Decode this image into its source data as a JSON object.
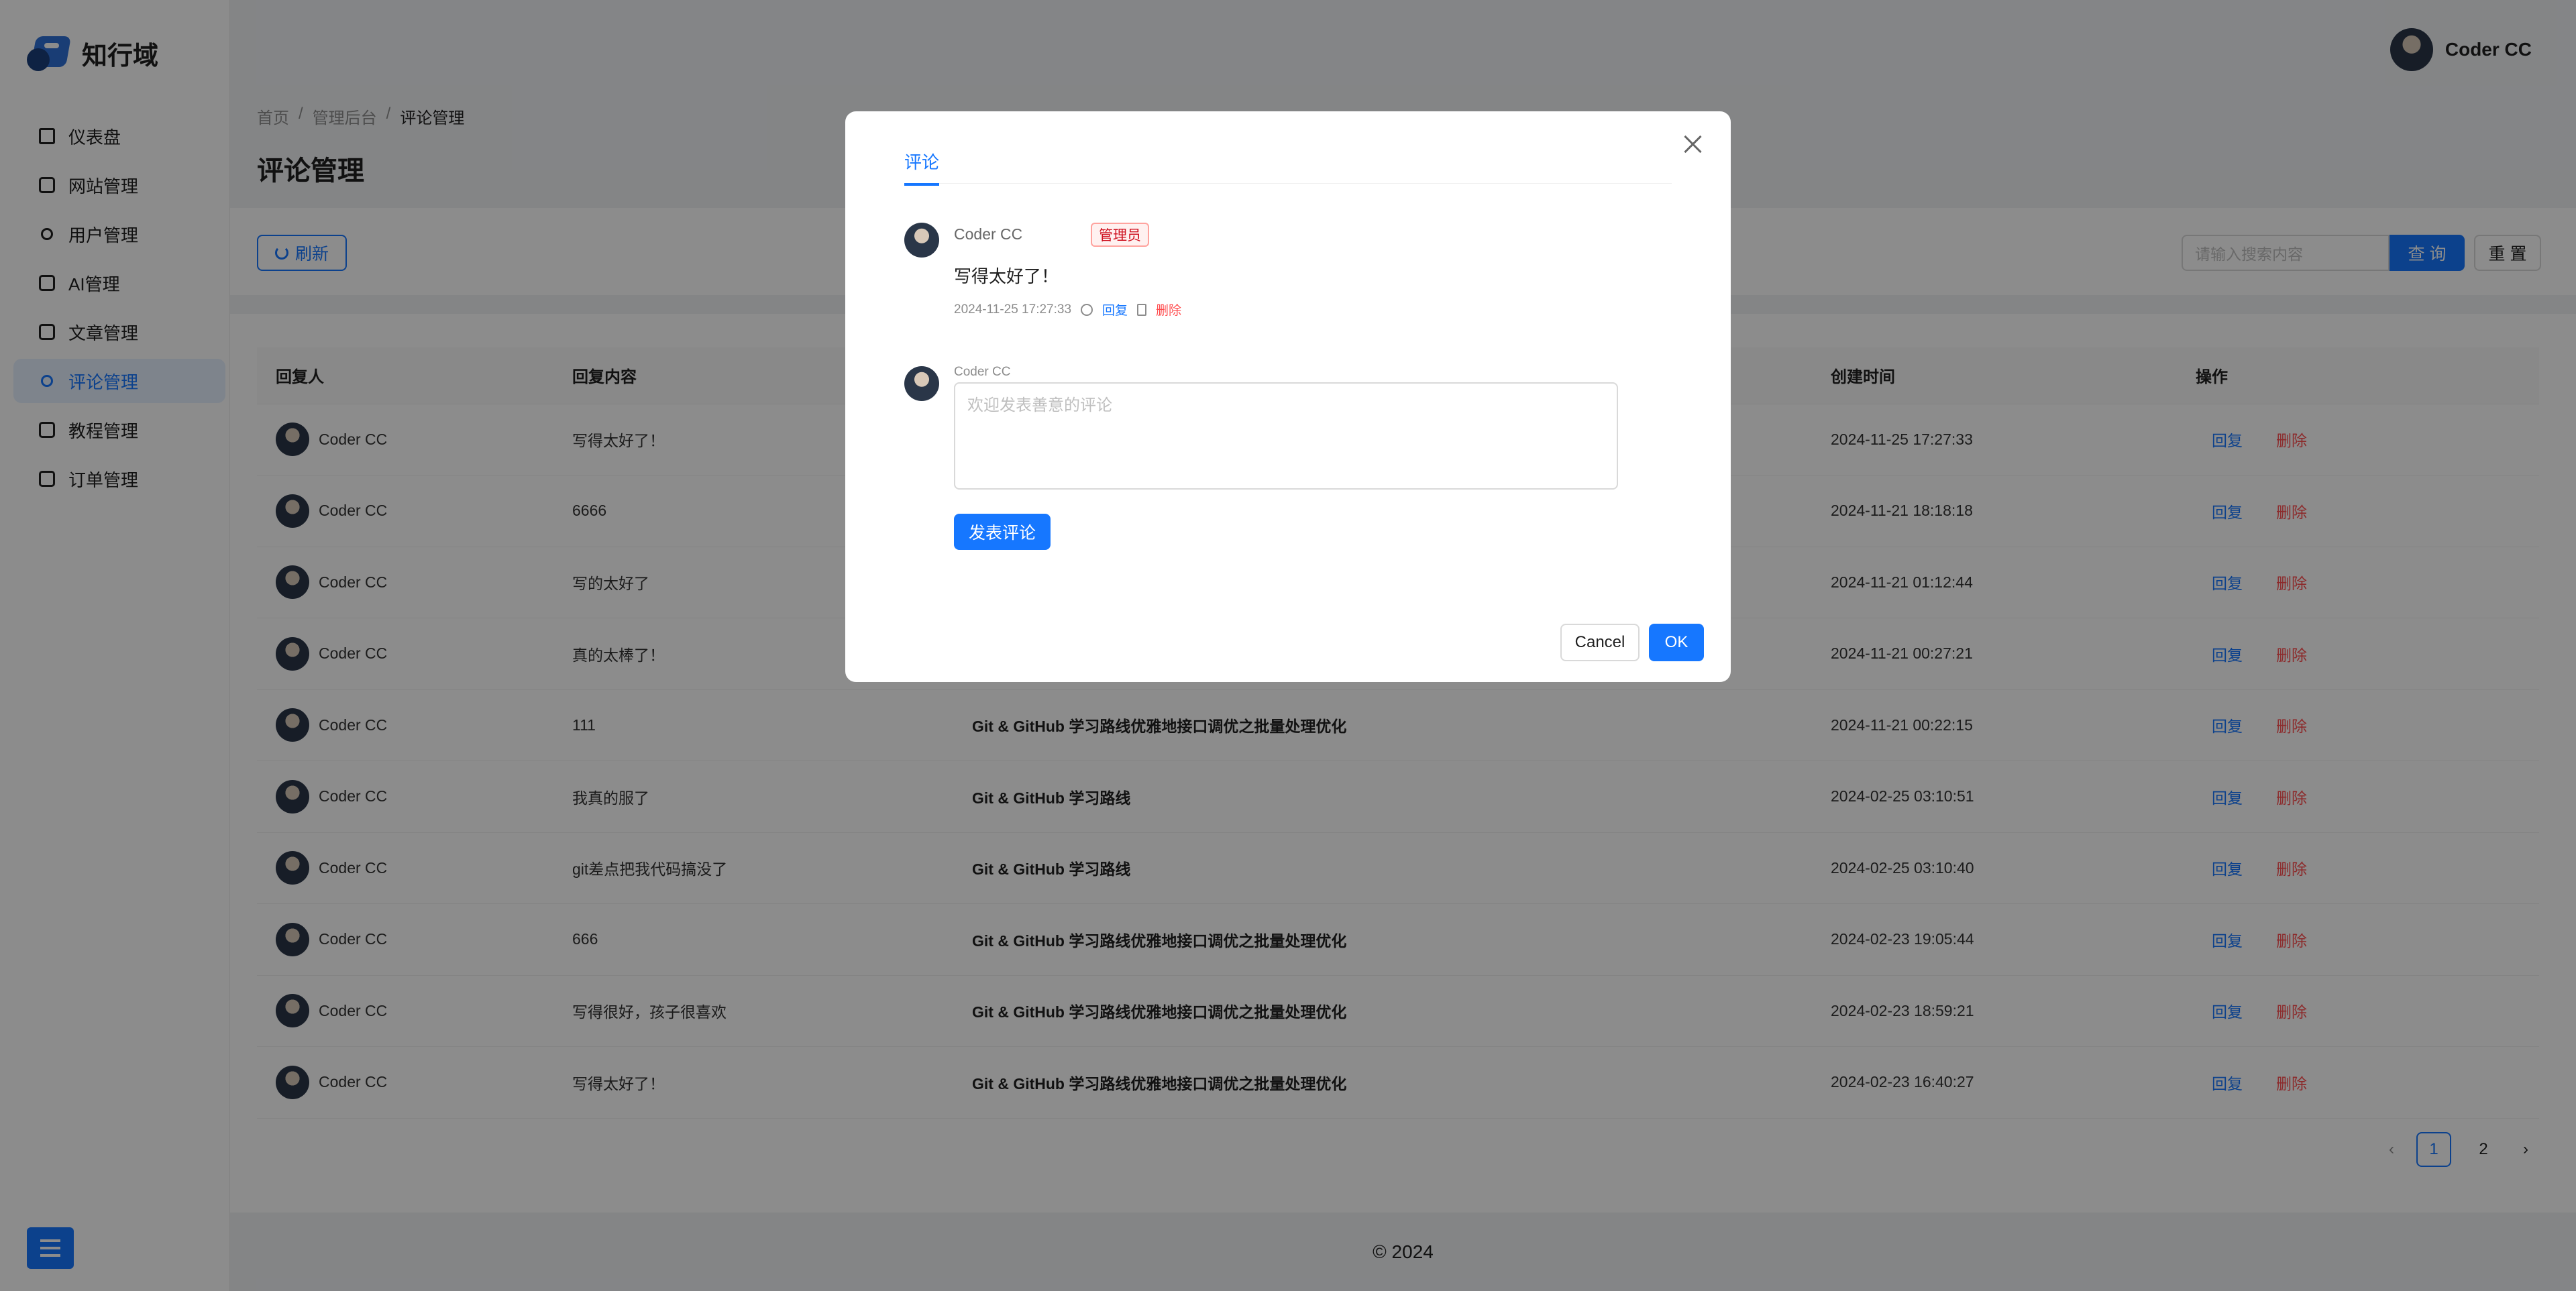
{
  "brand": {
    "name": "知行域"
  },
  "sidebar": {
    "items": [
      {
        "label": "仪表盘",
        "icon": "home-icon"
      },
      {
        "label": "网站管理",
        "icon": "grid-icon"
      },
      {
        "label": "用户管理",
        "icon": "user-icon"
      },
      {
        "label": "AI管理",
        "icon": "ai-icon"
      },
      {
        "label": "文章管理",
        "icon": "article-icon"
      },
      {
        "label": "评论管理",
        "icon": "comment-icon",
        "active": true
      },
      {
        "label": "教程管理",
        "icon": "tutorial-icon"
      },
      {
        "label": "订单管理",
        "icon": "order-icon"
      }
    ]
  },
  "header": {
    "user_name": "Coder CC"
  },
  "breadcrumb": [
    "首页",
    "管理后台",
    "评论管理"
  ],
  "page_title": "评论管理",
  "toolbar": {
    "refresh_label": "刷新",
    "search_placeholder": "请输入搜索内容",
    "query_label": "查 询",
    "reset_label": "重 置"
  },
  "table": {
    "headers": [
      "回复人",
      "回复内容",
      "",
      "创建时间",
      "操作"
    ],
    "reply_label": "回复",
    "delete_label": "删除",
    "rows": [
      {
        "user": "Coder CC",
        "content": "写得太好了！",
        "article": "",
        "time": "2024-11-25 17:27:33"
      },
      {
        "user": "Coder CC",
        "content": "6666",
        "article": "",
        "time": "2024-11-21 18:18:18"
      },
      {
        "user": "Coder CC",
        "content": "写的太好了",
        "article": "",
        "time": "2024-11-21 01:12:44"
      },
      {
        "user": "Coder CC",
        "content": "真的太棒了！",
        "article": "",
        "time": "2024-11-21 00:27:21"
      },
      {
        "user": "Coder CC",
        "content": "111",
        "article": "Git & GitHub 学习路线优雅地接口调优之批量处理优化",
        "time": "2024-11-21 00:22:15"
      },
      {
        "user": "Coder CC",
        "content": "我真的服了",
        "article": "Git & GitHub 学习路线",
        "time": "2024-02-25 03:10:51"
      },
      {
        "user": "Coder CC",
        "content": "git差点把我代码搞没了",
        "article": "Git & GitHub 学习路线",
        "time": "2024-02-25 03:10:40"
      },
      {
        "user": "Coder CC",
        "content": "666",
        "article": "Git & GitHub 学习路线优雅地接口调优之批量处理优化",
        "time": "2024-02-23 19:05:44"
      },
      {
        "user": "Coder CC",
        "content": "写得很好，孩子很喜欢",
        "article": "Git & GitHub 学习路线优雅地接口调优之批量处理优化",
        "time": "2024-02-23 18:59:21"
      },
      {
        "user": "Coder CC",
        "content": "写得太好了！",
        "article": "Git & GitHub 学习路线优雅地接口调优之批量处理优化",
        "time": "2024-02-23 16:40:27"
      }
    ]
  },
  "pagination": {
    "pages": [
      "1",
      "2"
    ],
    "current": "1",
    "prev": "‹",
    "next": "›"
  },
  "footer": {
    "text": "© 2024"
  },
  "modal": {
    "tab": "评论",
    "comment": {
      "author": "Coder CC",
      "badge": "管理员",
      "text": "写得太好了！",
      "time": "2024-11-25 17:27:33",
      "reply_label": "回复",
      "delete_label": "删除"
    },
    "editor": {
      "author": "Coder CC",
      "placeholder": "欢迎发表善意的评论",
      "submit_label": "发表评论"
    },
    "cancel_label": "Cancel",
    "ok_label": "OK"
  },
  "colors": {
    "primary": "#1677ff",
    "danger": "#ff4d4f",
    "mask": "rgba(0,0,0,0.45)"
  }
}
